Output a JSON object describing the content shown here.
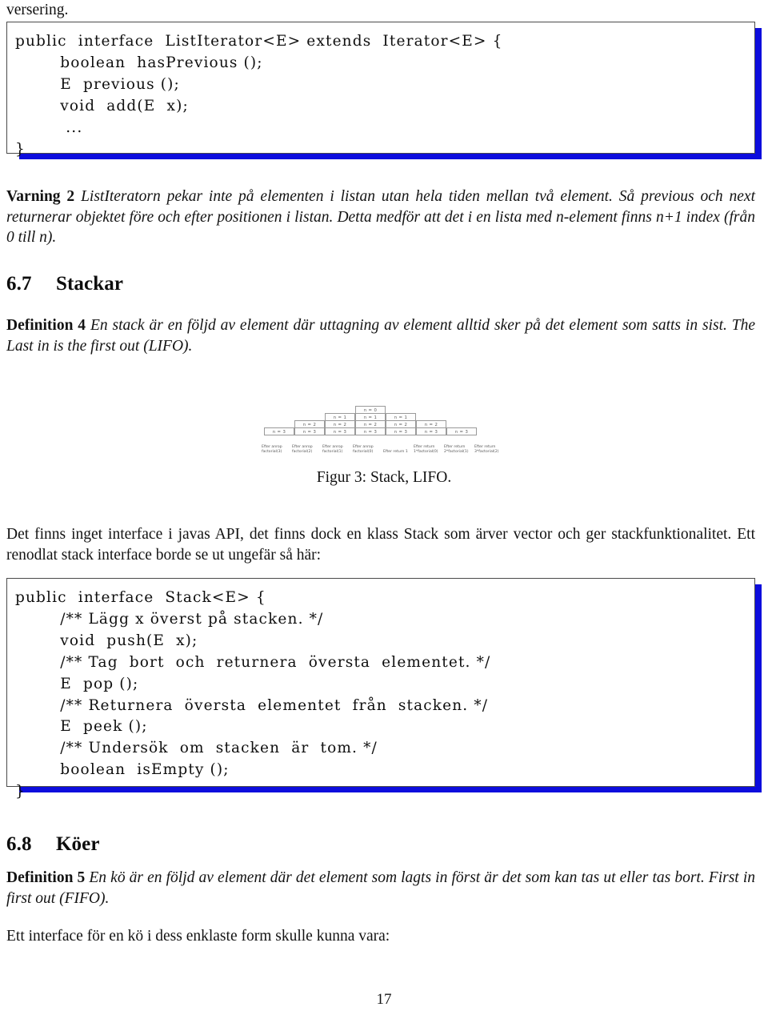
{
  "document": {
    "page_number": "17",
    "continuation_line": "versering."
  },
  "code_listing_1": {
    "lines": [
      "public  interface  ListIterator<E> extends  Iterator<E> {",
      "        boolean  hasPrevious ();",
      "        E  previous ();",
      "        void  add(E  x);",
      "         ...",
      "}"
    ]
  },
  "warning_2": {
    "label": "Varning 2",
    "text": "ListIteratorn pekar inte på elementen i listan utan hela tiden mellan två element. Så previous och next returnerar objektet före och efter positionen i listan. Detta medför att det i en lista med n-element finns n+1 index (från 0 till n)."
  },
  "section_6_7": {
    "number": "6.7",
    "title": "Stackar"
  },
  "definition_4": {
    "label": "Definition 4",
    "text": "En stack är en följd av element där uttagning av element alltid sker på det element som satts in sist. The Last in is the first out (LIFO)."
  },
  "figure_3": {
    "caption": "Figur 3: Stack, LIFO.",
    "columns": [
      {
        "cells": [
          "n = 3"
        ],
        "label": "Efter anrop factorial(3)"
      },
      {
        "cells": [
          "n = 2",
          "n = 3"
        ],
        "label": "Efter anrop factorial(2)"
      },
      {
        "cells": [
          "n = 1",
          "n = 2",
          "n = 3"
        ],
        "label": "Efter anrop factorial(1)"
      },
      {
        "cells": [
          "n = 0",
          "n = 1",
          "n = 2",
          "n = 3"
        ],
        "label": "Efter anrop factorial(0)"
      },
      {
        "cells": [
          "n = 1",
          "n = 2",
          "n = 3"
        ],
        "label": "Efter return 1"
      },
      {
        "cells": [
          "n = 2",
          "n = 3"
        ],
        "label": "Efter return 1*factorial(0)"
      },
      {
        "cells": [
          "n = 3"
        ],
        "label": "Efter return 2*factorial(1)"
      },
      {
        "cells": [],
        "label": "Efter return 3*factorial(2)"
      }
    ]
  },
  "paragraph_stack_api": {
    "text": "Det finns inget interface i javas API, det finns dock en klass Stack som ärver vector och ger stackfunktionalitet. Ett renodlat stack interface borde se ut ungefär så här:"
  },
  "code_listing_2": {
    "lines": [
      "public  interface  Stack<E> {",
      "        /** Lägg x överst på stacken. */",
      "        void  push(E  x);",
      "        /** Tag  bort  och  returnera  översta  elementet. */",
      "        E  pop ();",
      "        /** Returnera  översta  elementet  från  stacken. */",
      "        E  peek ();",
      "        /** Undersök  om  stacken  är  tom. */",
      "        boolean  isEmpty ();",
      "}"
    ]
  },
  "section_6_8": {
    "number": "6.8",
    "title": "Köer"
  },
  "definition_5": {
    "label": "Definition 5",
    "text": "En kö är en följd av element där det element som lagts in först är det som kan tas ut eller tas bort. First in first out (FIFO)."
  },
  "paragraph_queue_intro": {
    "text": "Ett interface för en kö i dess enklaste form skulle kunna vara:"
  },
  "colors": {
    "shadow_blue": "#0d0ddd",
    "box_border": "#4a4a4a",
    "text": "#131313"
  }
}
